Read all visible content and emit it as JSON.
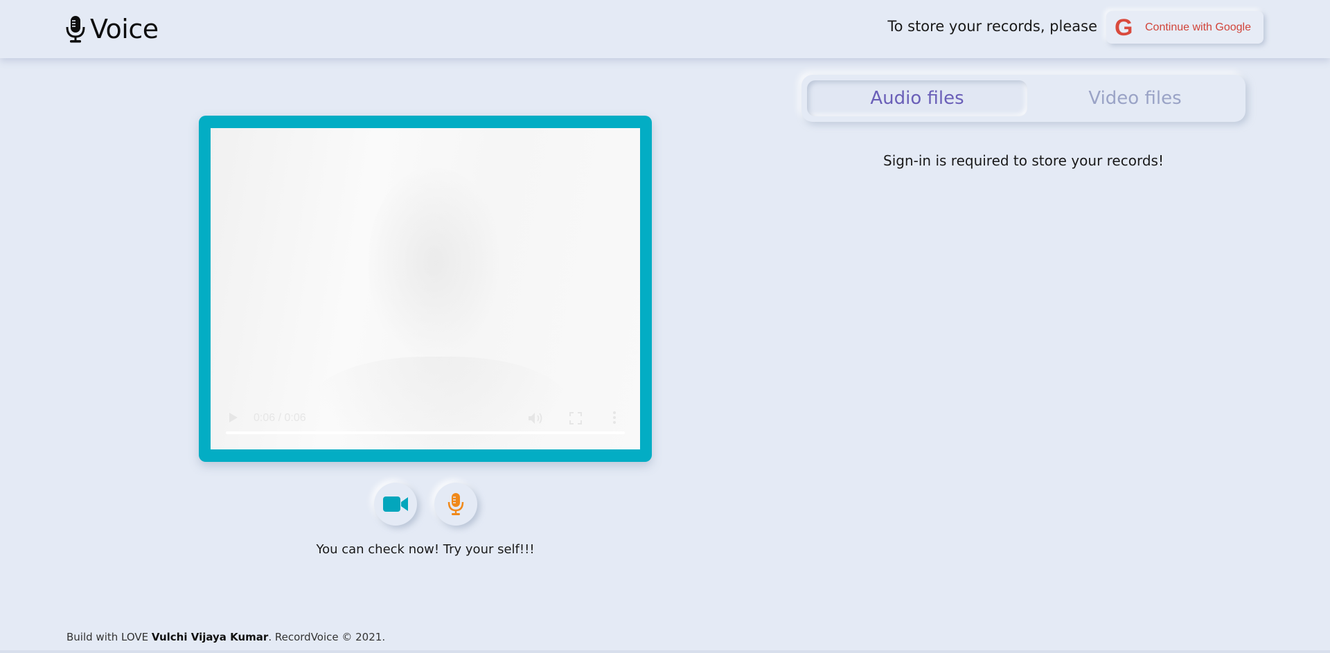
{
  "header": {
    "brand_name": "Voice",
    "brand_icon": "microphone-icon",
    "signin_prompt": "To store your records, please",
    "google_button": {
      "icon": "G",
      "label": "Continue with Google"
    }
  },
  "recorder": {
    "player": {
      "time": "0:06 / 0:06"
    },
    "video_button_icon": "video-camera-icon",
    "mic_button_icon": "microphone-icon",
    "status_text": "You can check now! Try your self!!!"
  },
  "files": {
    "tabs": [
      {
        "label": "Audio files",
        "active": true
      },
      {
        "label": "Video files",
        "active": false
      }
    ],
    "message": "Sign-in is required to store your records!"
  },
  "footer": {
    "prefix": "Build with LOVE ",
    "author": "Vulchi Vijaya Kumar",
    "suffix": ". RecordVoice © 2021."
  },
  "colors": {
    "background": "#e4eaf5",
    "video_frame": "#03adc4",
    "google_red": "#d94a3d",
    "active_tab": "#6a5fb8",
    "inactive_tab": "#9aa3c6",
    "mic_orange": "#f0891a"
  }
}
